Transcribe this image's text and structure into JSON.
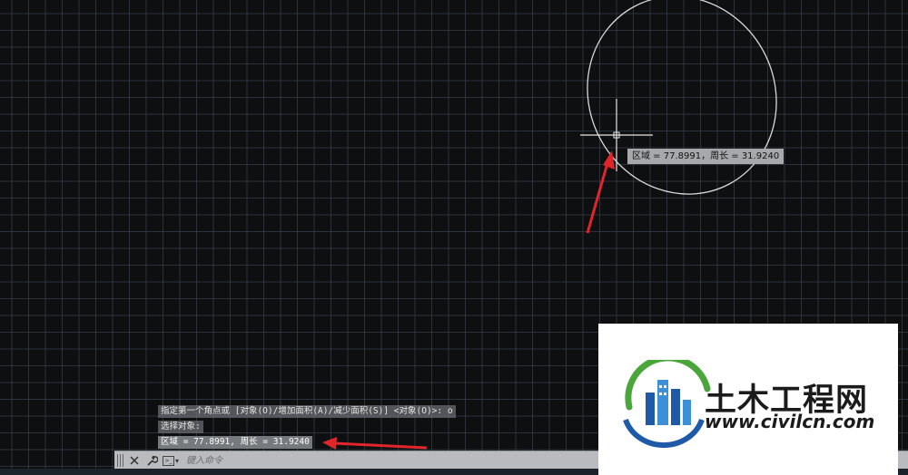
{
  "viewport": {
    "background": "#0e0f11",
    "grid_color": "#464e58",
    "ellipse_color": "#d9d9d9",
    "crosshair_color": "#e8e8e8",
    "annotation_color": "#e0262a"
  },
  "tooltip": {
    "text": "区域 = 77.8991，周长 = 31.9240"
  },
  "command_history": [
    "指定第一个角点或 [对象(O)/增加面积(A)/减少面积(S)] <对象(O)>: o",
    "选择对象:",
    "区域 = 77.8991, 周长 = 31.9240"
  ],
  "command_bar": {
    "placeholder": "键入命令",
    "close_icon": "close-icon",
    "customize_icon": "wrench-icon",
    "prompt_icon": "command-prompt-icon"
  },
  "watermark": {
    "title": "土木工程网",
    "url": "www.civilcn.com",
    "logo_colors": {
      "blue": "#1e5aa8",
      "green": "#4aa63a",
      "light_blue": "#3d8fd6"
    }
  }
}
